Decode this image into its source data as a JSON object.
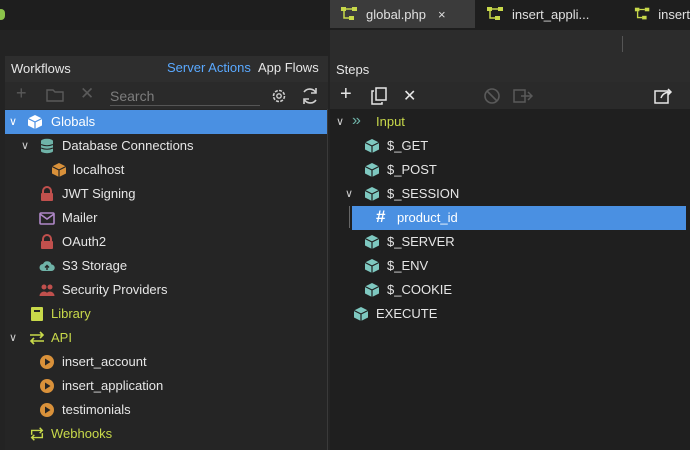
{
  "tabs": [
    {
      "label": "global.php",
      "active": true,
      "close": "×"
    },
    {
      "label": "insert_appli...",
      "active": false
    },
    {
      "label": "insert",
      "active": false
    }
  ],
  "workflows_panel": {
    "title": "Workflows",
    "server_actions": "Server Actions",
    "app_flows": "App Flows",
    "search_placeholder": "Search"
  },
  "tree": {
    "globals": "Globals",
    "database_connections": "Database Connections",
    "localhost": "localhost",
    "jwt_signing": "JWT Signing",
    "mailer": "Mailer",
    "oauth2": "OAuth2",
    "s3_storage": "S3 Storage",
    "security_providers": "Security Providers",
    "library": "Library",
    "api": "API",
    "insert_account": "insert_account",
    "insert_application": "insert_application",
    "testimonials": "testimonials",
    "webhooks": "Webhooks"
  },
  "steps_panel": {
    "title": "Steps",
    "input": "Input",
    "get": "$_GET",
    "post": "$_POST",
    "session": "$_SESSION",
    "product_id": "product_id",
    "server": "$_SERVER",
    "env": "$_ENV",
    "cookie": "$_COOKIE",
    "execute": "EXECUTE"
  },
  "colors": {
    "accent_blue": "#4a90e2",
    "link_blue": "#5aa9ff",
    "green_label": "#c8d94a",
    "cube_teal": "#7ec8c0",
    "db_teal": "#6fb3a8",
    "lock_red": "#c0504d",
    "play_orange": "#d9913a"
  }
}
